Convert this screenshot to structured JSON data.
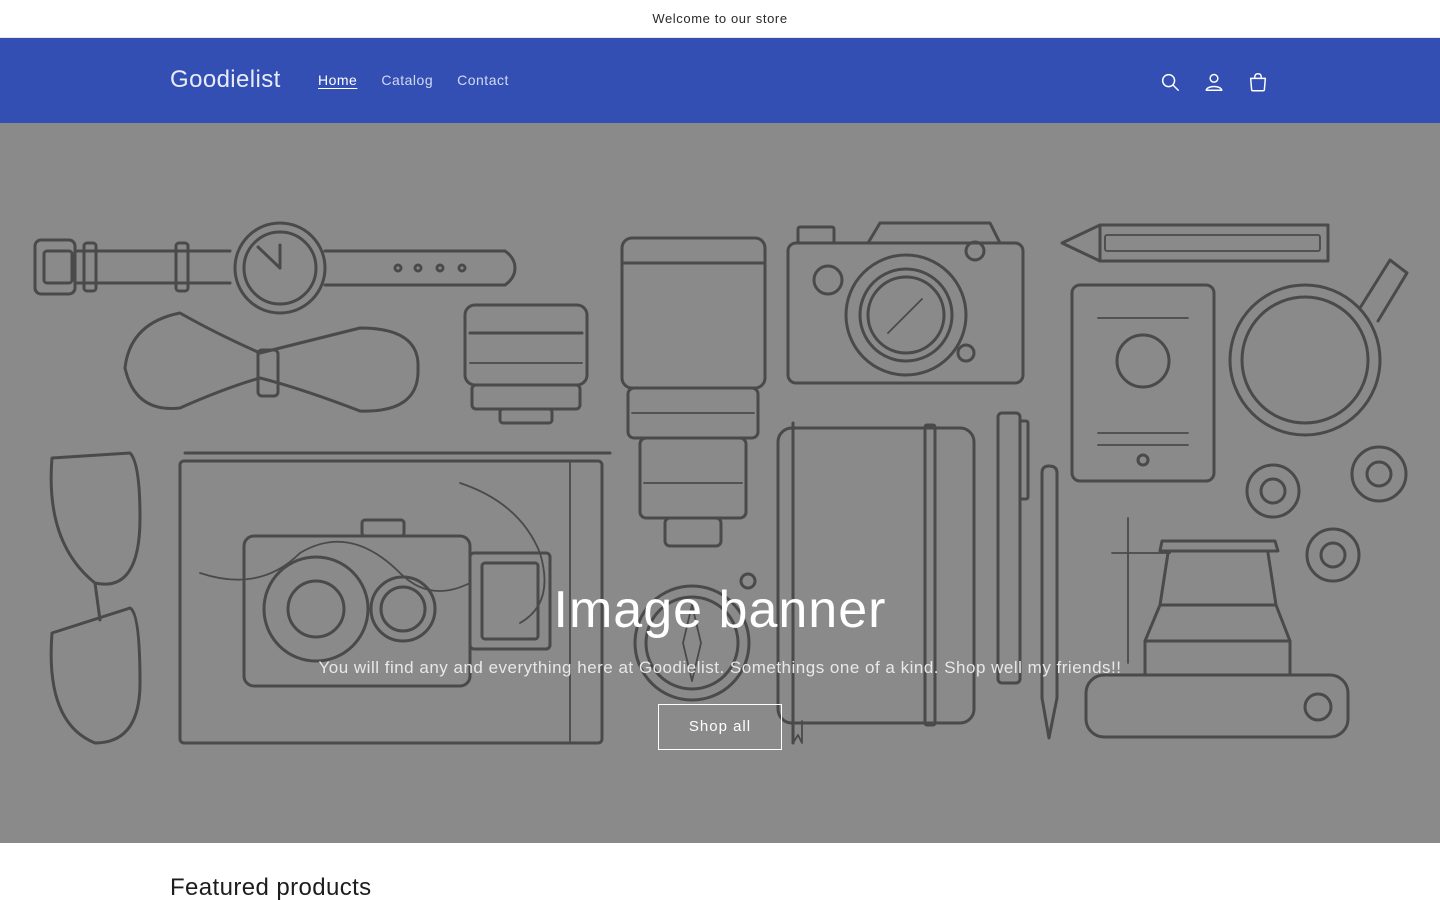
{
  "announcement": {
    "text": "Welcome to our store"
  },
  "header": {
    "logo": "Goodielist",
    "nav": [
      {
        "label": "Home",
        "active": true
      },
      {
        "label": "Catalog",
        "active": false
      },
      {
        "label": "Contact",
        "active": false
      }
    ],
    "icons": [
      "search-icon",
      "account-icon",
      "cart-icon"
    ],
    "background_color": "#334fb4"
  },
  "banner": {
    "title": "Image banner",
    "text": "You will find any and everything here at Goodielist. Somethings one of a kind. Shop well my friends!!",
    "button_label": "Shop all",
    "overlay_color": "#8a8a8a"
  },
  "featured": {
    "heading": "Featured products"
  }
}
